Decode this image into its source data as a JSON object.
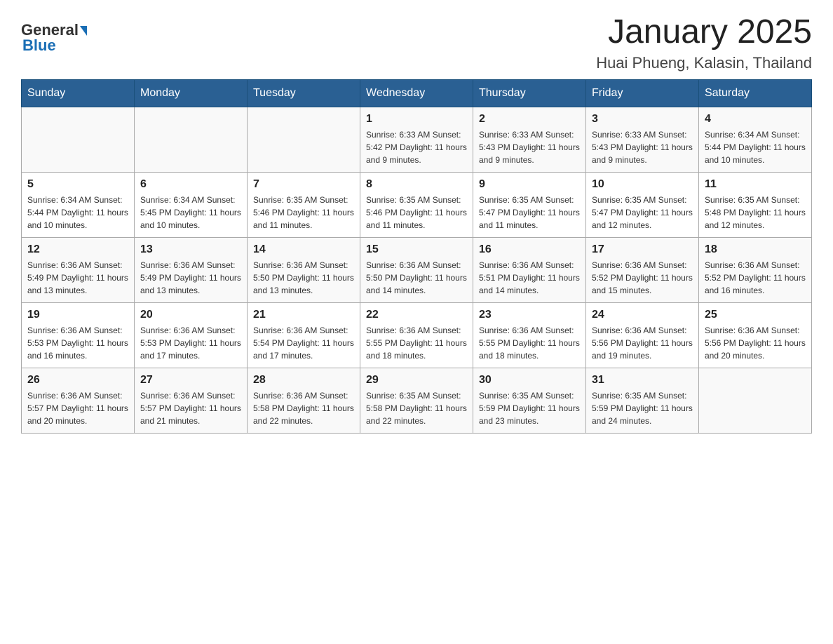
{
  "header": {
    "logo_general": "General",
    "logo_blue": "Blue",
    "title": "January 2025",
    "location": "Huai Phueng, Kalasin, Thailand"
  },
  "weekdays": [
    "Sunday",
    "Monday",
    "Tuesday",
    "Wednesday",
    "Thursday",
    "Friday",
    "Saturday"
  ],
  "weeks": [
    [
      {
        "day": "",
        "info": ""
      },
      {
        "day": "",
        "info": ""
      },
      {
        "day": "",
        "info": ""
      },
      {
        "day": "1",
        "info": "Sunrise: 6:33 AM\nSunset: 5:42 PM\nDaylight: 11 hours and 9 minutes."
      },
      {
        "day": "2",
        "info": "Sunrise: 6:33 AM\nSunset: 5:43 PM\nDaylight: 11 hours and 9 minutes."
      },
      {
        "day": "3",
        "info": "Sunrise: 6:33 AM\nSunset: 5:43 PM\nDaylight: 11 hours and 9 minutes."
      },
      {
        "day": "4",
        "info": "Sunrise: 6:34 AM\nSunset: 5:44 PM\nDaylight: 11 hours and 10 minutes."
      }
    ],
    [
      {
        "day": "5",
        "info": "Sunrise: 6:34 AM\nSunset: 5:44 PM\nDaylight: 11 hours and 10 minutes."
      },
      {
        "day": "6",
        "info": "Sunrise: 6:34 AM\nSunset: 5:45 PM\nDaylight: 11 hours and 10 minutes."
      },
      {
        "day": "7",
        "info": "Sunrise: 6:35 AM\nSunset: 5:46 PM\nDaylight: 11 hours and 11 minutes."
      },
      {
        "day": "8",
        "info": "Sunrise: 6:35 AM\nSunset: 5:46 PM\nDaylight: 11 hours and 11 minutes."
      },
      {
        "day": "9",
        "info": "Sunrise: 6:35 AM\nSunset: 5:47 PM\nDaylight: 11 hours and 11 minutes."
      },
      {
        "day": "10",
        "info": "Sunrise: 6:35 AM\nSunset: 5:47 PM\nDaylight: 11 hours and 12 minutes."
      },
      {
        "day": "11",
        "info": "Sunrise: 6:35 AM\nSunset: 5:48 PM\nDaylight: 11 hours and 12 minutes."
      }
    ],
    [
      {
        "day": "12",
        "info": "Sunrise: 6:36 AM\nSunset: 5:49 PM\nDaylight: 11 hours and 13 minutes."
      },
      {
        "day": "13",
        "info": "Sunrise: 6:36 AM\nSunset: 5:49 PM\nDaylight: 11 hours and 13 minutes."
      },
      {
        "day": "14",
        "info": "Sunrise: 6:36 AM\nSunset: 5:50 PM\nDaylight: 11 hours and 13 minutes."
      },
      {
        "day": "15",
        "info": "Sunrise: 6:36 AM\nSunset: 5:50 PM\nDaylight: 11 hours and 14 minutes."
      },
      {
        "day": "16",
        "info": "Sunrise: 6:36 AM\nSunset: 5:51 PM\nDaylight: 11 hours and 14 minutes."
      },
      {
        "day": "17",
        "info": "Sunrise: 6:36 AM\nSunset: 5:52 PM\nDaylight: 11 hours and 15 minutes."
      },
      {
        "day": "18",
        "info": "Sunrise: 6:36 AM\nSunset: 5:52 PM\nDaylight: 11 hours and 16 minutes."
      }
    ],
    [
      {
        "day": "19",
        "info": "Sunrise: 6:36 AM\nSunset: 5:53 PM\nDaylight: 11 hours and 16 minutes."
      },
      {
        "day": "20",
        "info": "Sunrise: 6:36 AM\nSunset: 5:53 PM\nDaylight: 11 hours and 17 minutes."
      },
      {
        "day": "21",
        "info": "Sunrise: 6:36 AM\nSunset: 5:54 PM\nDaylight: 11 hours and 17 minutes."
      },
      {
        "day": "22",
        "info": "Sunrise: 6:36 AM\nSunset: 5:55 PM\nDaylight: 11 hours and 18 minutes."
      },
      {
        "day": "23",
        "info": "Sunrise: 6:36 AM\nSunset: 5:55 PM\nDaylight: 11 hours and 18 minutes."
      },
      {
        "day": "24",
        "info": "Sunrise: 6:36 AM\nSunset: 5:56 PM\nDaylight: 11 hours and 19 minutes."
      },
      {
        "day": "25",
        "info": "Sunrise: 6:36 AM\nSunset: 5:56 PM\nDaylight: 11 hours and 20 minutes."
      }
    ],
    [
      {
        "day": "26",
        "info": "Sunrise: 6:36 AM\nSunset: 5:57 PM\nDaylight: 11 hours and 20 minutes."
      },
      {
        "day": "27",
        "info": "Sunrise: 6:36 AM\nSunset: 5:57 PM\nDaylight: 11 hours and 21 minutes."
      },
      {
        "day": "28",
        "info": "Sunrise: 6:36 AM\nSunset: 5:58 PM\nDaylight: 11 hours and 22 minutes."
      },
      {
        "day": "29",
        "info": "Sunrise: 6:35 AM\nSunset: 5:58 PM\nDaylight: 11 hours and 22 minutes."
      },
      {
        "day": "30",
        "info": "Sunrise: 6:35 AM\nSunset: 5:59 PM\nDaylight: 11 hours and 23 minutes."
      },
      {
        "day": "31",
        "info": "Sunrise: 6:35 AM\nSunset: 5:59 PM\nDaylight: 11 hours and 24 minutes."
      },
      {
        "day": "",
        "info": ""
      }
    ]
  ]
}
